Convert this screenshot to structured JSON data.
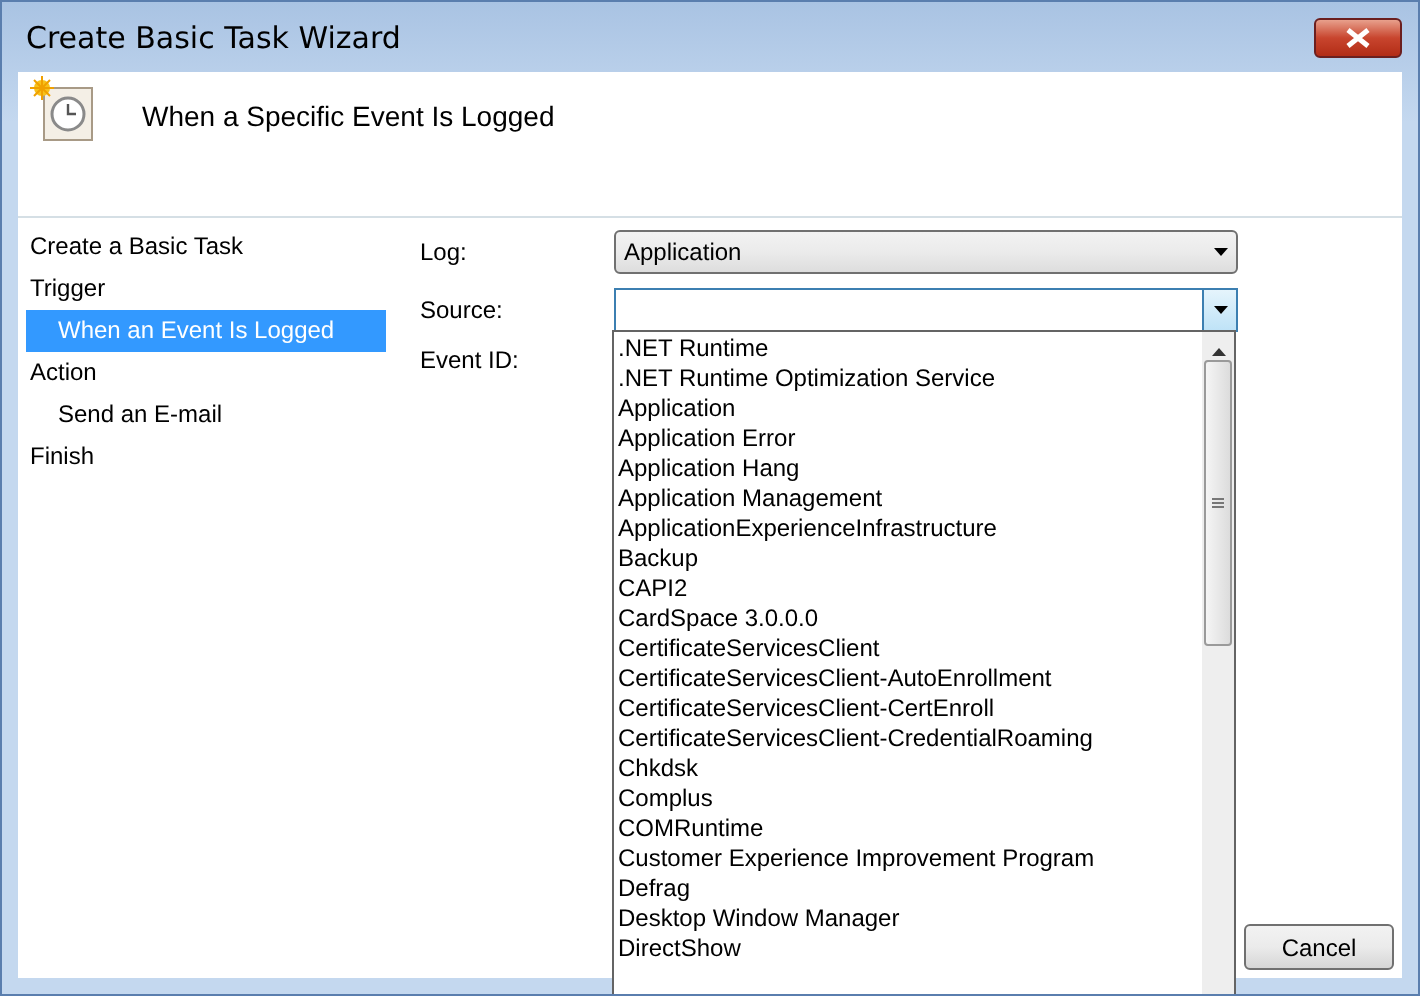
{
  "window": {
    "title": "Create Basic Task Wizard"
  },
  "header": {
    "title": "When a Specific Event Is Logged"
  },
  "steps": [
    {
      "label": "Create a Basic Task",
      "selected": false
    },
    {
      "label": "Trigger",
      "selected": false,
      "children": [
        {
          "label": "When an Event Is Logged",
          "selected": true
        }
      ]
    },
    {
      "label": "Action",
      "selected": false,
      "children": [
        {
          "label": "Send an E-mail",
          "selected": false
        }
      ]
    },
    {
      "label": "Finish",
      "selected": false
    }
  ],
  "form": {
    "log": {
      "label": "Log:",
      "value": "Application"
    },
    "source": {
      "label": "Source:",
      "expanded": true
    },
    "event_id": {
      "label": "Event ID:"
    }
  },
  "source_list": [
    ".NET Runtime",
    ".NET Runtime Optimization Service",
    "Application",
    "Application Error",
    "Application Hang",
    "Application Management",
    "ApplicationExperienceInfrastructure",
    "Backup",
    "CAPI2",
    "CardSpace 3.0.0.0",
    "CertificateServicesClient",
    "CertificateServicesClient-AutoEnrollment",
    "CertificateServicesClient-CertEnroll",
    "CertificateServicesClient-CredentialRoaming",
    "Chkdsk",
    "Complus",
    "COMRuntime",
    "Customer Experience Improvement Program",
    "Defrag",
    "Desktop Window Manager",
    "DirectShow"
  ],
  "buttons": [
    {
      "label": "Cancel"
    }
  ]
}
